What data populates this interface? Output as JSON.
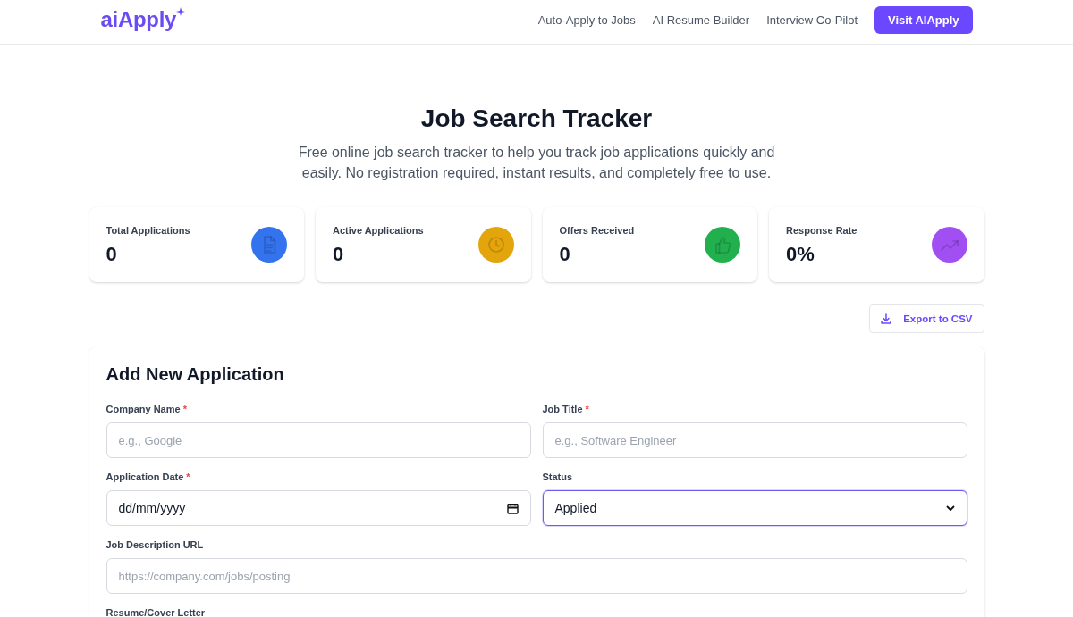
{
  "header": {
    "logo": "aiApply",
    "nav_links": [
      "Auto-Apply to Jobs",
      "AI Resume Builder",
      "Interview Co-Pilot"
    ],
    "cta_button": "Visit AIApply"
  },
  "hero": {
    "title": "Job Search Tracker",
    "subtitle": "Free online job search tracker to help you track job applications quickly and easily. No registration required, instant results, and completely free to use."
  },
  "stats": [
    {
      "label": "Total Applications",
      "value": "0",
      "color": "#3373ee"
    },
    {
      "label": "Active Applications",
      "value": "0",
      "color": "#e3a50b"
    },
    {
      "label": "Offers Received",
      "value": "0",
      "color": "#22b04f"
    },
    {
      "label": "Response Rate",
      "value": "0%",
      "color": "#a14ef2"
    }
  ],
  "export_button": "Export to CSV",
  "form": {
    "title": "Add New Application",
    "rows": [
      [
        {
          "kind": "text",
          "label": "Company Name",
          "required_mark": "*",
          "placeholder": "e.g., Google",
          "focused": false
        },
        {
          "kind": "text",
          "label": "Job Title",
          "required_mark": "*",
          "placeholder": "e.g., Software Engineer",
          "focused": false
        }
      ],
      [
        {
          "kind": "date",
          "label": "Application Date",
          "required_mark": "*",
          "value": "dd/mm/yyyy",
          "focused": false
        },
        {
          "kind": "select",
          "label": "Status",
          "value": "Applied",
          "focused": true
        }
      ],
      [
        {
          "kind": "text",
          "label": "Job Description URL",
          "placeholder": "https://company.com/jobs/posting",
          "focused": false
        }
      ],
      [
        {
          "kind": "cut_off",
          "label": "Resume/Cover Letter"
        }
      ]
    ]
  }
}
